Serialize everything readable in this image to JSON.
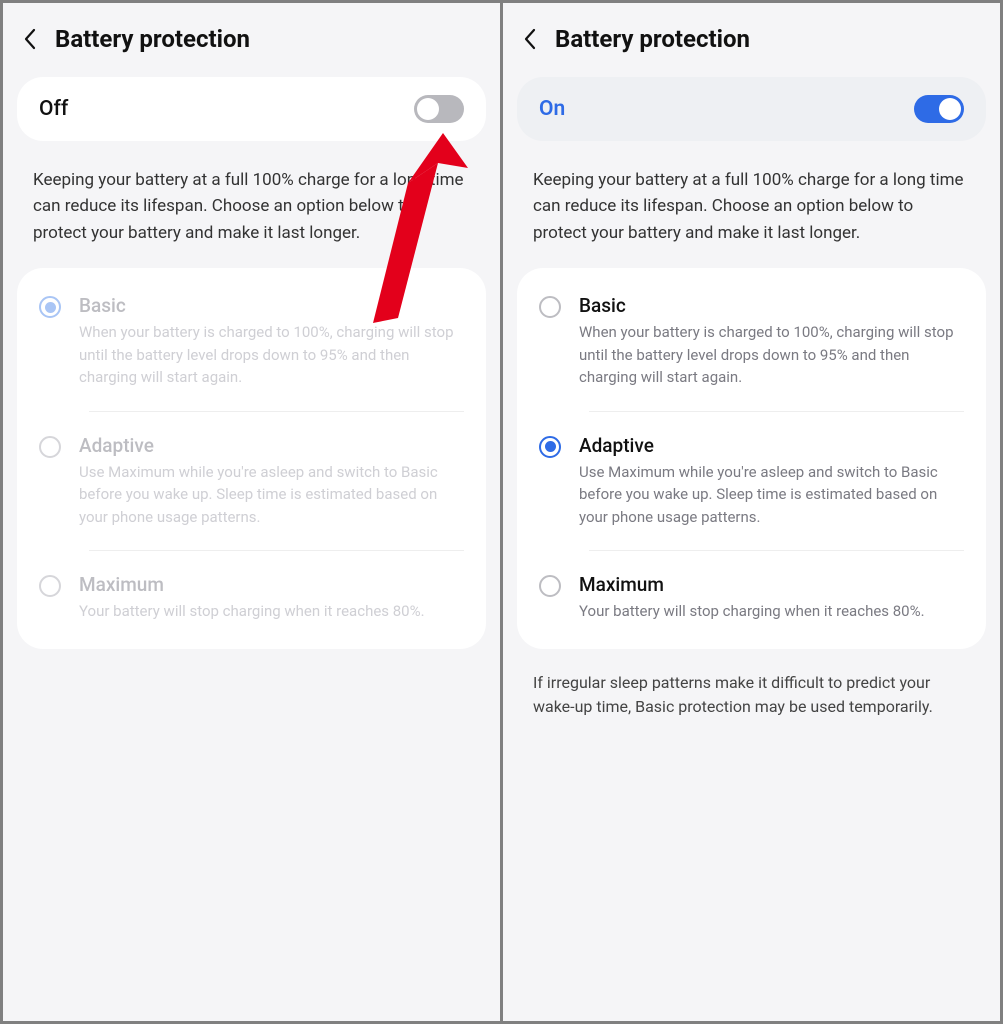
{
  "left": {
    "title": "Battery protection",
    "toggle_label": "Off",
    "toggle_on": false,
    "description": "Keeping your battery at a full 100% charge for a long time can reduce its lifespan. Choose an option below to protect your battery and make it last longer.",
    "selected_index": 0,
    "disabled": true,
    "options": [
      {
        "title": "Basic",
        "sub": "When your battery is charged to 100%, charging will stop until the battery level drops down to 95% and then charging will start again."
      },
      {
        "title": "Adaptive",
        "sub": "Use Maximum while you're asleep and switch to Basic before you wake up. Sleep time is estimated based on your phone usage patterns."
      },
      {
        "title": "Maximum",
        "sub": "Your battery will stop charging when it reaches 80%."
      }
    ]
  },
  "right": {
    "title": "Battery protection",
    "toggle_label": "On",
    "toggle_on": true,
    "description": "Keeping your battery at a full 100% charge for a long time can reduce its lifespan. Choose an option below to protect your battery and make it last longer.",
    "selected_index": 1,
    "disabled": false,
    "options": [
      {
        "title": "Basic",
        "sub": "When your battery is charged to 100%, charging will stop until the battery level drops down to 95% and then charging will start again."
      },
      {
        "title": "Adaptive",
        "sub": "Use Maximum while you're asleep and switch to Basic before you wake up. Sleep time is estimated based on your phone usage patterns."
      },
      {
        "title": "Maximum",
        "sub": "Your battery will stop charging when it reaches 80%."
      }
    ],
    "footer_note": "If irregular sleep patterns make it difficult to predict your wake-up time, Basic protection may be used temporarily."
  },
  "annotation": {
    "arrow_color": "#e3001b"
  }
}
